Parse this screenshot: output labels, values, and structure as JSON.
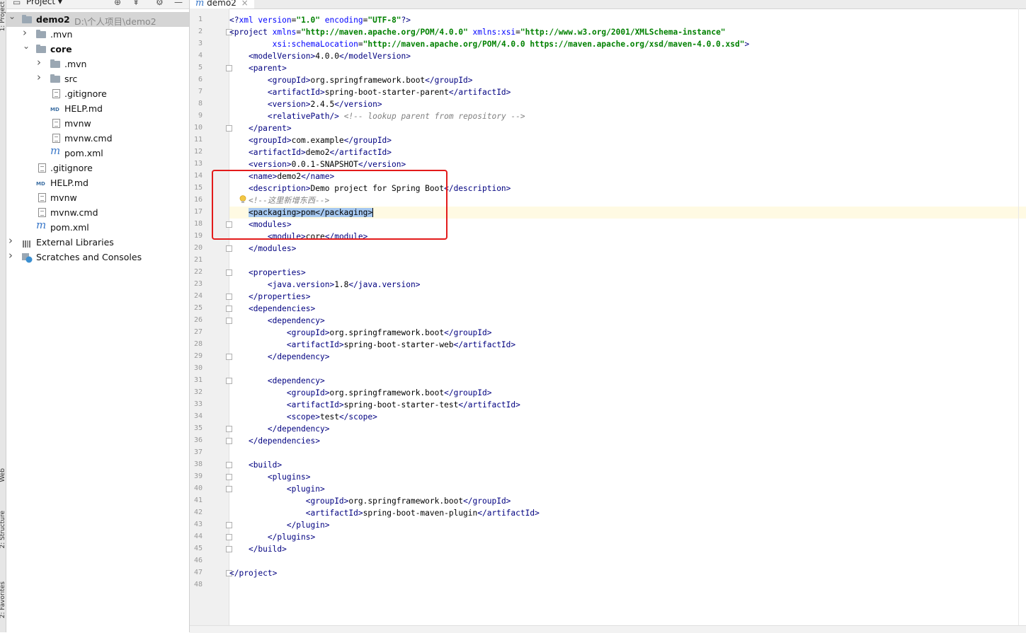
{
  "side_tools": [
    "1: Project",
    "Web",
    "2: Structure",
    "2: Favorites"
  ],
  "project_panel": {
    "title": "Project",
    "tree": [
      {
        "label": "demo2",
        "path": "D:\\个人项目\\demo2",
        "icon": "folder-icon",
        "arrow": "expanded",
        "depth": 0,
        "bold": true,
        "selected": true
      },
      {
        "label": ".mvn",
        "icon": "folder-icon",
        "arrow": "collapsed",
        "depth": 1
      },
      {
        "label": "core",
        "icon": "module-folder-icon",
        "arrow": "expanded",
        "depth": 1,
        "bold": true
      },
      {
        "label": ".mvn",
        "icon": "folder-icon",
        "arrow": "collapsed",
        "depth": 2
      },
      {
        "label": "src",
        "icon": "folder-icon",
        "arrow": "collapsed",
        "depth": 2
      },
      {
        "label": ".gitignore",
        "icon": "text-file-icon",
        "depth": 2
      },
      {
        "label": "HELP.md",
        "icon": "markdown-file-icon",
        "depth": 2
      },
      {
        "label": "mvnw",
        "icon": "text-file-icon",
        "depth": 2
      },
      {
        "label": "mvnw.cmd",
        "icon": "text-file-icon",
        "depth": 2
      },
      {
        "label": "pom.xml",
        "icon": "maven-file-icon",
        "depth": 2
      },
      {
        "label": ".gitignore",
        "icon": "text-file-icon",
        "depth": 1
      },
      {
        "label": "HELP.md",
        "icon": "markdown-file-icon",
        "depth": 1
      },
      {
        "label": "mvnw",
        "icon": "text-file-icon",
        "depth": 1
      },
      {
        "label": "mvnw.cmd",
        "icon": "text-file-icon",
        "depth": 1
      },
      {
        "label": "pom.xml",
        "icon": "maven-file-icon",
        "depth": 1
      },
      {
        "label": "External Libraries",
        "icon": "libraries-icon",
        "arrow": "collapsed",
        "depth": 0
      },
      {
        "label": "Scratches and Consoles",
        "icon": "scratches-icon",
        "arrow": "collapsed",
        "depth": 0
      }
    ]
  },
  "editor": {
    "tab_label": "demo2",
    "tab_close": "×",
    "current_line": 17,
    "lines": [
      [
        [
          "tg",
          "<?"
        ],
        [
          "an",
          "xml version"
        ],
        [
          "tx",
          "="
        ],
        [
          "av",
          "\"1.0\""
        ],
        [
          "an",
          " encoding"
        ],
        [
          "tx",
          "="
        ],
        [
          "av",
          "\"UTF-8\""
        ],
        [
          "tg",
          "?>"
        ]
      ],
      [
        [
          "tg",
          "<project "
        ],
        [
          "an",
          "xmlns"
        ],
        [
          "tx",
          "="
        ],
        [
          "av",
          "\"http://maven.apache.org/POM/4.0.0\""
        ],
        [
          "an",
          " xmlns:xsi"
        ],
        [
          "tx",
          "="
        ],
        [
          "av",
          "\"http://www.w3.org/2001/XMLSchema-instance\""
        ]
      ],
      [
        [
          "tx",
          "         "
        ],
        [
          "an",
          "xsi:schemaLocation"
        ],
        [
          "tx",
          "="
        ],
        [
          "av",
          "\"http://maven.apache.org/POM/4.0.0 https://maven.apache.org/xsd/maven-4.0.0.xsd\""
        ],
        [
          "tg",
          ">"
        ]
      ],
      [
        [
          "tx",
          "    "
        ],
        [
          "tg",
          "<modelVersion>"
        ],
        [
          "tx",
          "4.0.0"
        ],
        [
          "tg",
          "</modelVersion>"
        ]
      ],
      [
        [
          "tx",
          "    "
        ],
        [
          "tg",
          "<parent>"
        ]
      ],
      [
        [
          "tx",
          "        "
        ],
        [
          "tg",
          "<groupId>"
        ],
        [
          "tx",
          "org.springframework.boot"
        ],
        [
          "tg",
          "</groupId>"
        ]
      ],
      [
        [
          "tx",
          "        "
        ],
        [
          "tg",
          "<artifactId>"
        ],
        [
          "tx",
          "spring-boot-starter-parent"
        ],
        [
          "tg",
          "</artifactId>"
        ]
      ],
      [
        [
          "tx",
          "        "
        ],
        [
          "tg",
          "<version>"
        ],
        [
          "tx",
          "2.4.5"
        ],
        [
          "tg",
          "</version>"
        ]
      ],
      [
        [
          "tx",
          "        "
        ],
        [
          "tg",
          "<relativePath/>"
        ],
        [
          "tx",
          " "
        ],
        [
          "cm",
          "<!-- lookup parent from repository -->"
        ]
      ],
      [
        [
          "tx",
          "    "
        ],
        [
          "tg",
          "</parent>"
        ]
      ],
      [
        [
          "tx",
          "    "
        ],
        [
          "tg",
          "<groupId>"
        ],
        [
          "tx",
          "com.example"
        ],
        [
          "tg",
          "</groupId>"
        ]
      ],
      [
        [
          "tx",
          "    "
        ],
        [
          "tg",
          "<artifactId>"
        ],
        [
          "tx",
          "demo2"
        ],
        [
          "tg",
          "</artifactId>"
        ]
      ],
      [
        [
          "tx",
          "    "
        ],
        [
          "tg",
          "<version>"
        ],
        [
          "tx",
          "0.0.1-SNAPSHOT"
        ],
        [
          "tg",
          "</version>"
        ]
      ],
      [
        [
          "tx",
          "    "
        ],
        [
          "tg",
          "<name>"
        ],
        [
          "tx",
          "demo2"
        ],
        [
          "tg",
          "</name>"
        ]
      ],
      [
        [
          "tx",
          "    "
        ],
        [
          "tg",
          "<description>"
        ],
        [
          "tx",
          "Demo project for Spring Boot"
        ],
        [
          "tg",
          "</description>"
        ]
      ],
      [
        [
          "tx",
          "    "
        ],
        [
          "cm",
          "<!--这里新增东西-->"
        ]
      ],
      [
        [
          "tx",
          "    "
        ],
        [
          "sel",
          "<packaging>pom</packaging>"
        ]
      ],
      [
        [
          "tx",
          "    "
        ],
        [
          "tg",
          "<modules>"
        ]
      ],
      [
        [
          "tx",
          "        "
        ],
        [
          "tg",
          "<module>"
        ],
        [
          "tx",
          "core"
        ],
        [
          "tg",
          "</module>"
        ]
      ],
      [
        [
          "tx",
          "    "
        ],
        [
          "tg",
          "</modules>"
        ]
      ],
      [],
      [
        [
          "tx",
          "    "
        ],
        [
          "tg",
          "<properties>"
        ]
      ],
      [
        [
          "tx",
          "        "
        ],
        [
          "tg",
          "<java.version>"
        ],
        [
          "tx",
          "1.8"
        ],
        [
          "tg",
          "</java.version>"
        ]
      ],
      [
        [
          "tx",
          "    "
        ],
        [
          "tg",
          "</properties>"
        ]
      ],
      [
        [
          "tx",
          "    "
        ],
        [
          "tg",
          "<dependencies>"
        ]
      ],
      [
        [
          "tx",
          "        "
        ],
        [
          "tg",
          "<dependency>"
        ]
      ],
      [
        [
          "tx",
          "            "
        ],
        [
          "tg",
          "<groupId>"
        ],
        [
          "tx",
          "org.springframework.boot"
        ],
        [
          "tg",
          "</groupId>"
        ]
      ],
      [
        [
          "tx",
          "            "
        ],
        [
          "tg",
          "<artifactId>"
        ],
        [
          "tx",
          "spring-boot-starter-web"
        ],
        [
          "tg",
          "</artifactId>"
        ]
      ],
      [
        [
          "tx",
          "        "
        ],
        [
          "tg",
          "</dependency>"
        ]
      ],
      [],
      [
        [
          "tx",
          "        "
        ],
        [
          "tg",
          "<dependency>"
        ]
      ],
      [
        [
          "tx",
          "            "
        ],
        [
          "tg",
          "<groupId>"
        ],
        [
          "tx",
          "org.springframework.boot"
        ],
        [
          "tg",
          "</groupId>"
        ]
      ],
      [
        [
          "tx",
          "            "
        ],
        [
          "tg",
          "<artifactId>"
        ],
        [
          "tx",
          "spring-boot-starter-test"
        ],
        [
          "tg",
          "</artifactId>"
        ]
      ],
      [
        [
          "tx",
          "            "
        ],
        [
          "tg",
          "<scope>"
        ],
        [
          "tx",
          "test"
        ],
        [
          "tg",
          "</scope>"
        ]
      ],
      [
        [
          "tx",
          "        "
        ],
        [
          "tg",
          "</dependency>"
        ]
      ],
      [
        [
          "tx",
          "    "
        ],
        [
          "tg",
          "</dependencies>"
        ]
      ],
      [],
      [
        [
          "tx",
          "    "
        ],
        [
          "tg",
          "<build>"
        ]
      ],
      [
        [
          "tx",
          "        "
        ],
        [
          "tg",
          "<plugins>"
        ]
      ],
      [
        [
          "tx",
          "            "
        ],
        [
          "tg",
          "<plugin>"
        ]
      ],
      [
        [
          "tx",
          "                "
        ],
        [
          "tg",
          "<groupId>"
        ],
        [
          "tx",
          "org.springframework.boot"
        ],
        [
          "tg",
          "</groupId>"
        ]
      ],
      [
        [
          "tx",
          "                "
        ],
        [
          "tg",
          "<artifactId>"
        ],
        [
          "tx",
          "spring-boot-maven-plugin"
        ],
        [
          "tg",
          "</artifactId>"
        ]
      ],
      [
        [
          "tx",
          "            "
        ],
        [
          "tg",
          "</plugin>"
        ]
      ],
      [
        [
          "tx",
          "        "
        ],
        [
          "tg",
          "</plugins>"
        ]
      ],
      [
        [
          "tx",
          "    "
        ],
        [
          "tg",
          "</build>"
        ]
      ],
      [],
      [
        [
          "tg",
          "</project>"
        ]
      ],
      []
    ],
    "fold_lines": [
      2,
      5,
      10,
      18,
      20,
      22,
      24,
      25,
      26,
      29,
      31,
      35,
      36,
      38,
      39,
      40,
      43,
      44,
      45,
      47
    ]
  },
  "colors": {
    "annotation_box": "#e31b1b",
    "selection": "#a6c8f0",
    "current_line": "#fffae3"
  }
}
